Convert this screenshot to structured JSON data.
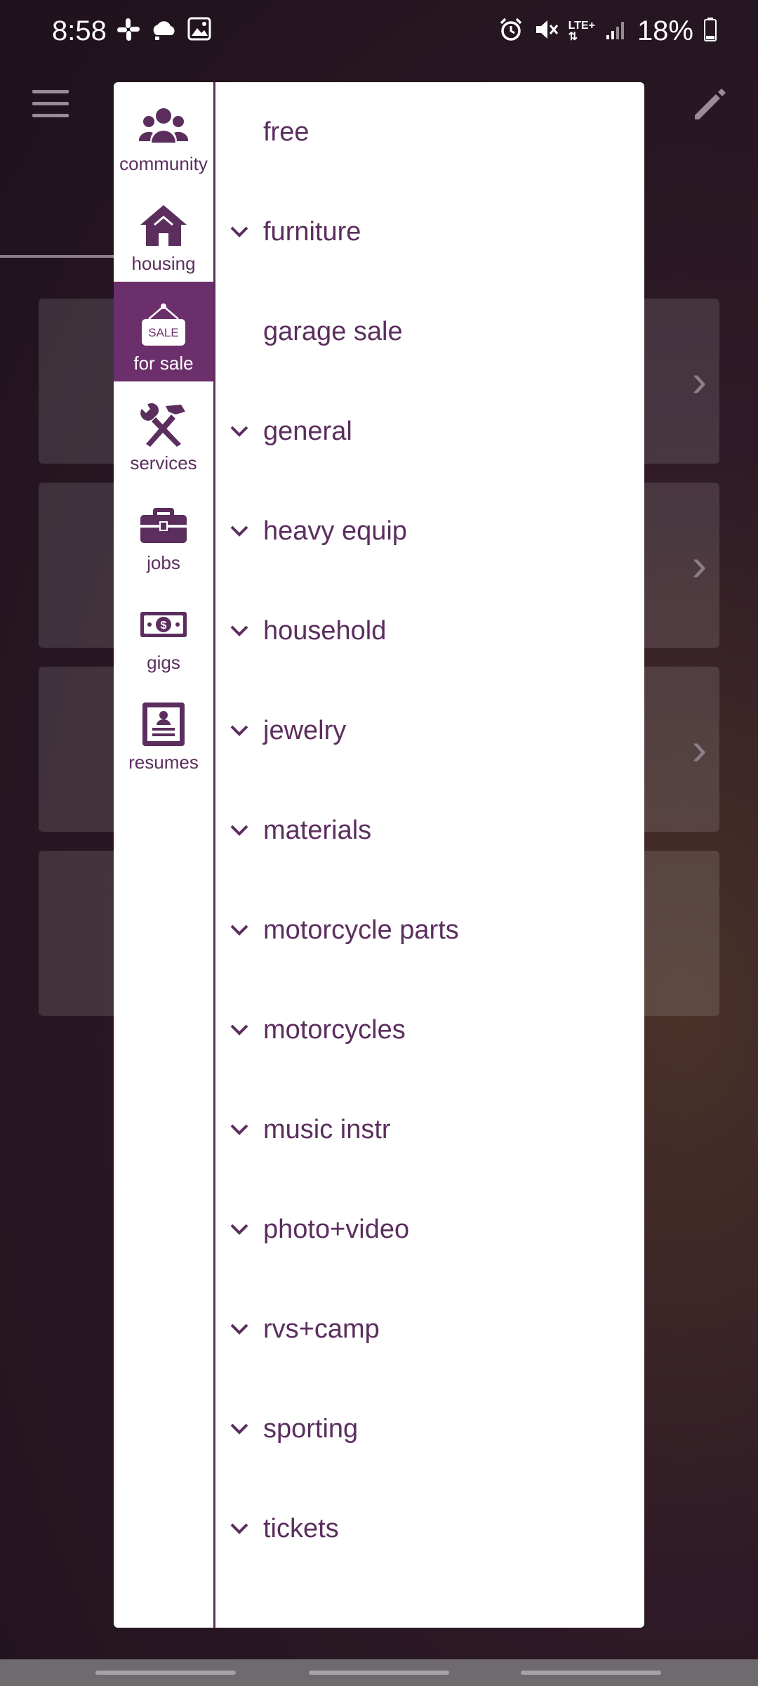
{
  "status_bar": {
    "time": "8:58",
    "network": "LTE+",
    "battery": "18%",
    "icons": [
      "slack-icon",
      "cloud-notification-icon",
      "gallery-icon",
      "alarm-icon",
      "mute-icon",
      "signal-icon",
      "battery-icon"
    ]
  },
  "drawer": {
    "rail": [
      {
        "label": "community",
        "icon": "community-icon",
        "active": false
      },
      {
        "label": "housing",
        "icon": "house-icon",
        "active": false
      },
      {
        "label": "for sale",
        "icon": "sale-sign-icon",
        "active": true,
        "sign_text": "SALE"
      },
      {
        "label": "services",
        "icon": "tools-icon",
        "active": false
      },
      {
        "label": "jobs",
        "icon": "briefcase-icon",
        "active": false
      },
      {
        "label": "gigs",
        "icon": "money-icon",
        "active": false
      },
      {
        "label": "resumes",
        "icon": "resume-icon",
        "active": false
      }
    ],
    "categories": [
      {
        "label": "free",
        "expandable": false
      },
      {
        "label": "furniture",
        "expandable": true
      },
      {
        "label": "garage sale",
        "expandable": false
      },
      {
        "label": "general",
        "expandable": true
      },
      {
        "label": "heavy equip",
        "expandable": true
      },
      {
        "label": "household",
        "expandable": true
      },
      {
        "label": "jewelry",
        "expandable": true
      },
      {
        "label": "materials",
        "expandable": true
      },
      {
        "label": "motorcycle parts",
        "expandable": true
      },
      {
        "label": "motorcycles",
        "expandable": true
      },
      {
        "label": "music instr",
        "expandable": true
      },
      {
        "label": "photo+video",
        "expandable": true
      },
      {
        "label": "rvs+camp",
        "expandable": true
      },
      {
        "label": "sporting",
        "expandable": true
      },
      {
        "label": "tickets",
        "expandable": true
      }
    ]
  },
  "colors": {
    "accent": "#5b2e5e",
    "active_bg": "#6b2f6b"
  }
}
